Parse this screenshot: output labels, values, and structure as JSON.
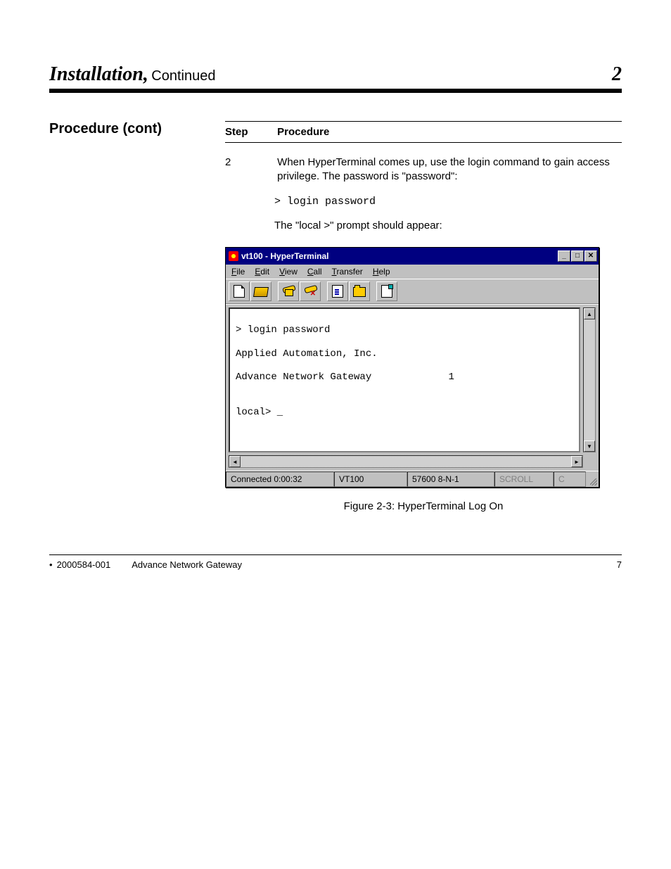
{
  "chapter": {
    "title": "Installation,",
    "subtitle": "Continued",
    "number": "2"
  },
  "section": {
    "label": "Procedure (cont)",
    "step_label": "Step",
    "step_num": "2",
    "procedure_label": "Procedure",
    "procedure_body_1": "When HyperTerminal comes up, use the login command to gain access privilege. The password is \"password\":",
    "procedure_cmd": "> login password",
    "procedure_body_2": "The \"local >\" prompt should appear:"
  },
  "hyperterminal": {
    "title": "vt100 - HyperTerminal",
    "menu": {
      "file": "File",
      "edit": "Edit",
      "view": "View",
      "call": "Call",
      "transfer": "Transfer",
      "help": "Help"
    },
    "terminal_lines": {
      "l1": "> login password",
      "l2": "Applied Automation, Inc.",
      "l3": "Advance Network Gateway             1",
      "l4": "",
      "l5": "local> _"
    },
    "status": {
      "connected": "Connected 0:00:32",
      "emulation": "VT100",
      "port": "57600 8-N-1",
      "scroll": "SCROLL",
      "caps": "C"
    }
  },
  "figure_caption": "Figure 2-3: HyperTerminal Log On",
  "footer": {
    "pub": "2000584-001",
    "title": "Advance Network Gateway",
    "page": "7"
  }
}
